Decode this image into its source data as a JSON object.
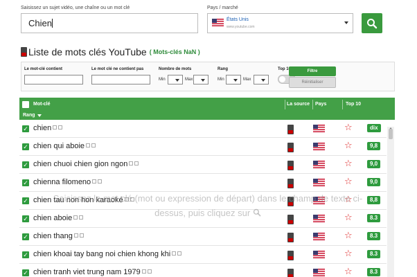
{
  "search": {
    "label": "Saisissez un sujet vidéo, une chaîne ou un mot clé",
    "value": "Chien"
  },
  "country": {
    "label": "Pays / marché",
    "name": "États Unis",
    "url": "www.youtube.com"
  },
  "title": {
    "text": "Liste de mots clés YouTube",
    "badge": "( Mots-clés NaN )"
  },
  "filters": {
    "contains_label": "Le mot-clé contient",
    "not_contains_label": "Le mot clé ne contient pas",
    "word_count_label": "Nombre de mots",
    "rank_label": "Rang",
    "top10_label": "Top 10",
    "min_label": "Min",
    "max_label": "Max",
    "filter_button": "Filtre",
    "reset_button": "Réinitialiser"
  },
  "table": {
    "headers": {
      "keyword": "Mot-clé",
      "source": "La source",
      "country": "Pays",
      "top10": "Top 10",
      "rank": "Rang"
    },
    "rows": [
      {
        "keyword": "chien",
        "score": "dix"
      },
      {
        "keyword": "chien qui aboie",
        "score": "9,8"
      },
      {
        "keyword": "chien chuoi chien gion ngon",
        "score": "9,0"
      },
      {
        "keyword": "chienna filomeno",
        "score": "9,0"
      },
      {
        "keyword": "chien tau non hon karaoké",
        "score": "8,8"
      },
      {
        "keyword": "chien aboie",
        "score": "8.3"
      },
      {
        "keyword": "chien thang",
        "score": "8.3"
      },
      {
        "keyword": "chien khoai tay bang noi chien khong khi",
        "score": "8.3"
      },
      {
        "keyword": "chien tranh viet trung nam 1979",
        "score": "8.3"
      }
    ]
  },
  "overlay": {
    "line1": "Saisissez le mot clé (mot ou expression de départ) dans le champ de texte ci-",
    "line2": "dessus, puis cliquez sur"
  },
  "colors": {
    "accent_green": "#43a047",
    "star_red": "#d22222",
    "link_blue": "#1a5fb4"
  }
}
